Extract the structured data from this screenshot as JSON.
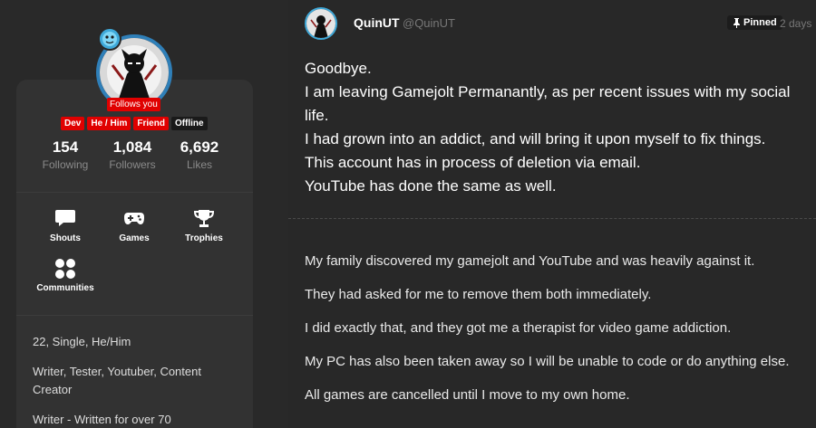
{
  "profile": {
    "follows_you": "Follows you",
    "tags": [
      "Dev",
      "He / Him",
      "Friend"
    ],
    "status": "Offline",
    "stats": [
      {
        "num": "154",
        "label": "Following"
      },
      {
        "num": "1,084",
        "label": "Followers"
      },
      {
        "num": "6,692",
        "label": "Likes"
      }
    ],
    "nav": [
      {
        "label": "Shouts",
        "icon": "chat-bubble-icon"
      },
      {
        "label": "Games",
        "icon": "gamepad-icon"
      },
      {
        "label": "Trophies",
        "icon": "trophy-icon"
      },
      {
        "label": "Communities",
        "icon": "communities-icon"
      }
    ],
    "bio": [
      "22, Single, He/Him",
      "Writer, Tester, Youtuber, Content Creator",
      "Writer - Written for over 70"
    ],
    "accent": "#e00000"
  },
  "post": {
    "author": "QuinUT",
    "handle": "@QuinUT",
    "pinned": "Pinned",
    "time": "2 days",
    "lead": [
      "Goodbye.",
      "I am leaving Gamejolt Permanantly, as per recent issues with my social life.",
      "I had grown into an addict, and will bring it upon myself to fix things.",
      "This account has in process of deletion via email.",
      "YouTube has done the same as well."
    ],
    "body": [
      "My family discovered my gamejolt and YouTube and was heavily against it.",
      "They had asked for me to remove them both immediately.",
      "I did exactly that, and they got me a therapist for video game addiction.",
      "My PC has also been taken away so I will be unable to code or do anything else.",
      "All games are cancelled until I move to my own home."
    ]
  }
}
